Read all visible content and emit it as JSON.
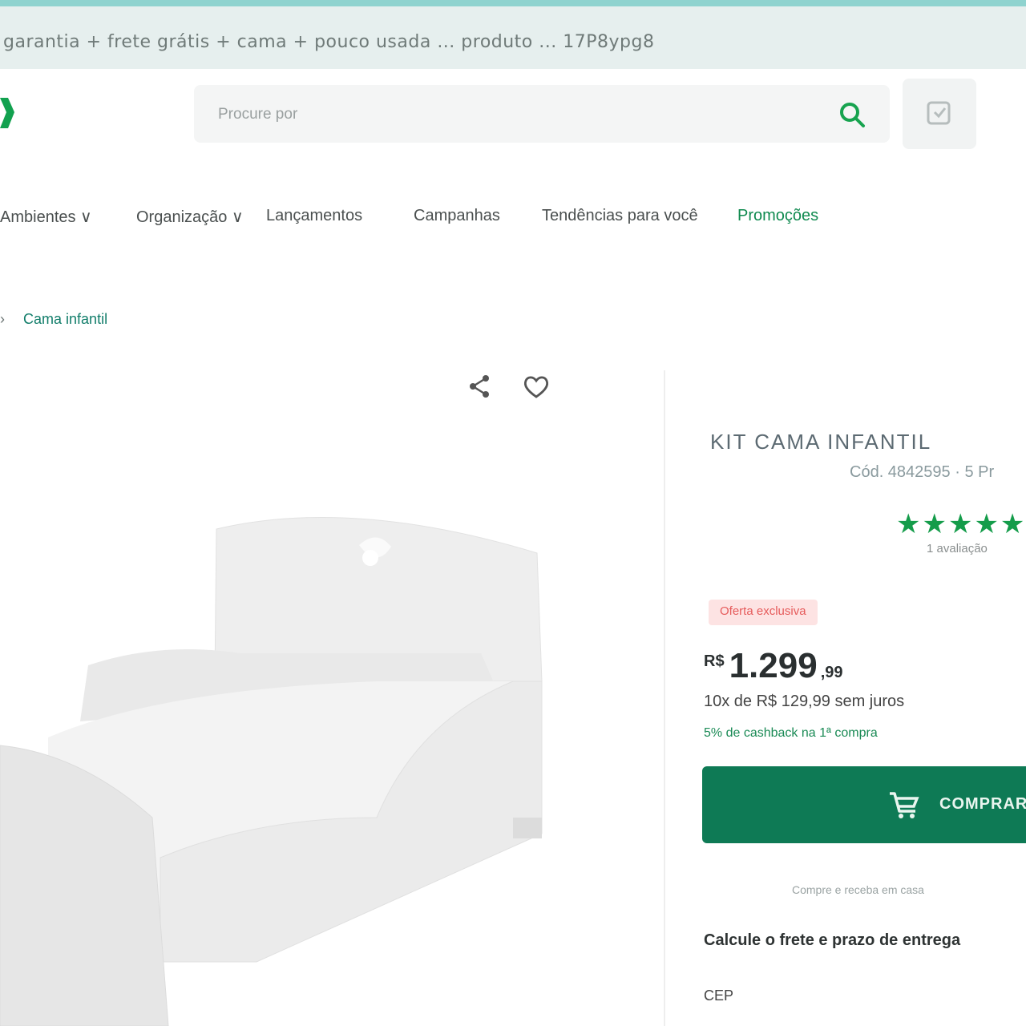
{
  "browser": {
    "url": "garantia + frete grátis + cama + pouco usada ... produto ... 17P8ypg8"
  },
  "header": {
    "logo": "X",
    "search_placeholder": "Procure por",
    "search_icon": "search-icon",
    "cart_icon": "cart-icon"
  },
  "nav": {
    "items": [
      "Ambientes ∨",
      "Organização ∨",
      "Lançamentos",
      "Campanhas",
      "Tendências para você",
      "Promoções"
    ]
  },
  "breadcrumb": {
    "home": "›",
    "current": "Cama infantil"
  },
  "product": {
    "title": "KIT CAMA INFANTIL",
    "ref": "Cód. 4842595 · 5 Pr",
    "stars": "★★★★★",
    "reviews": "1 avaliação",
    "badge": "Oferta exclusiva",
    "price_currency": "R$",
    "price_int": "1.299",
    "price_dec": ",99",
    "installments": "10x de R$ 129,99 sem juros",
    "cashback": "5% de cashback na 1ª compra",
    "buy_label": "COMPRAR",
    "shipping_note": "Compre e receba em casa",
    "delivery_title": "Calcule o frete e prazo de entrega",
    "cep_label": "CEP"
  },
  "colors": {
    "brand_green": "#0e7a55",
    "promo_green": "#0f8a4f",
    "star_green": "#149c4a",
    "badge_red": "#e65b5b"
  }
}
